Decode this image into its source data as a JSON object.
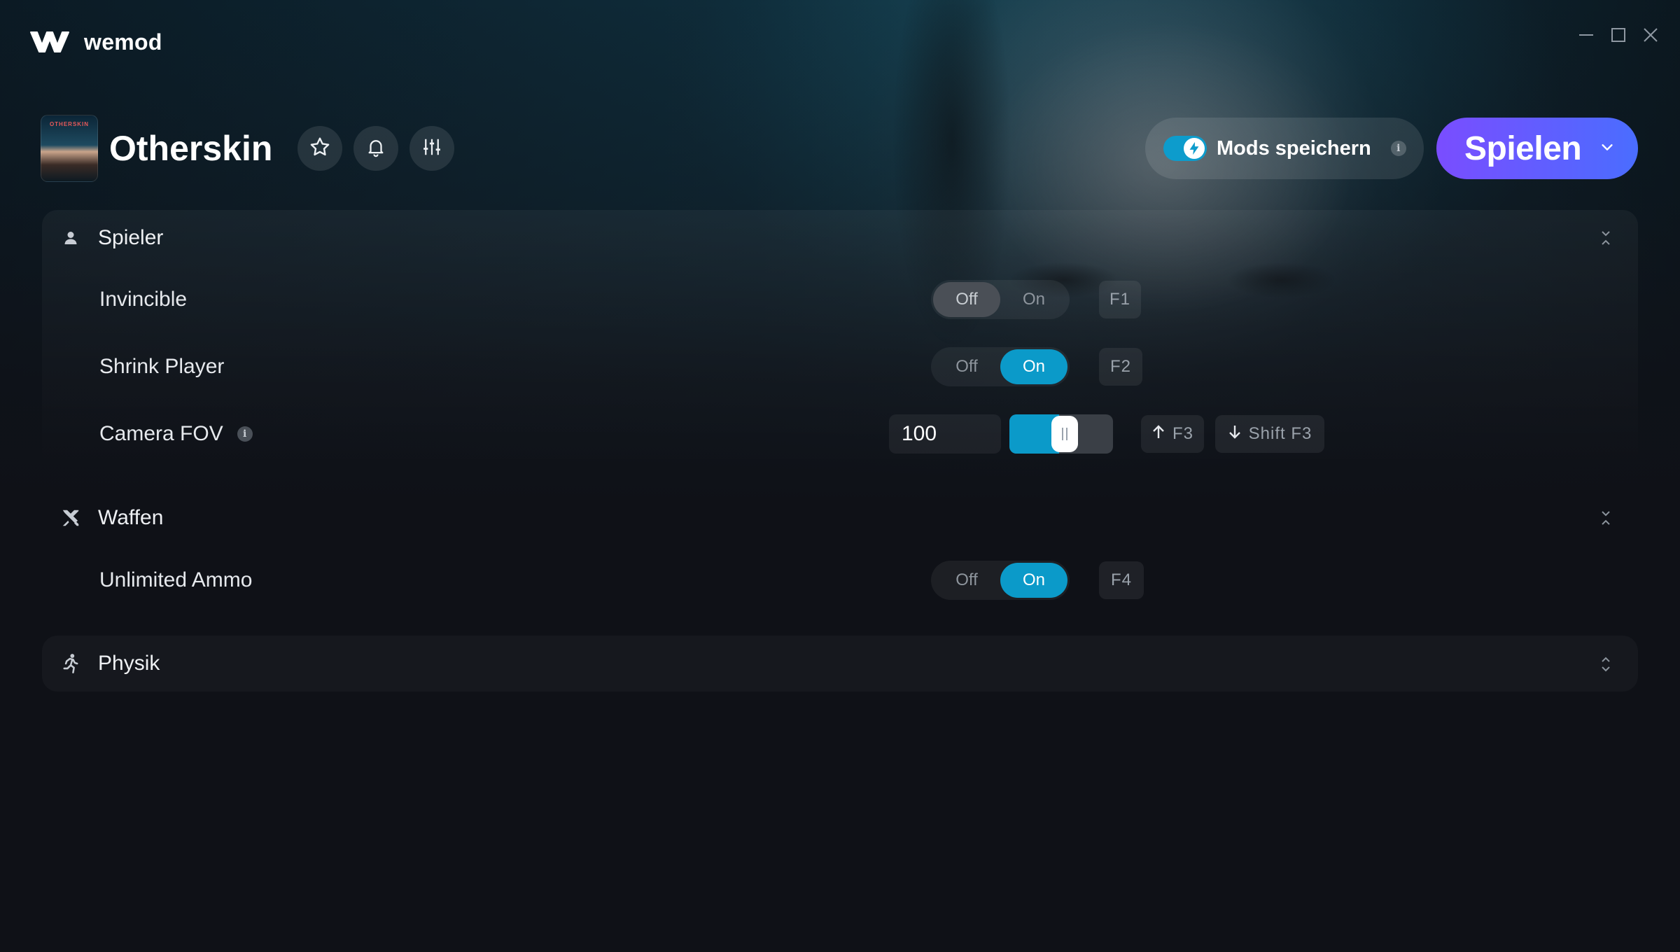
{
  "app": {
    "name": "wemod"
  },
  "game": {
    "title": "Otherskin",
    "cover_text": "OTHERSKIN"
  },
  "header_actions": {
    "favorite_icon": "star-icon",
    "notify_icon": "bell-icon",
    "settings_icon": "sliders-icon"
  },
  "save_mods": {
    "label": "Mods speichern",
    "info": "i",
    "enabled": true
  },
  "play": {
    "label": "Spielen"
  },
  "sections": [
    {
      "title": "Spieler",
      "icon": "person-icon",
      "expanded": true,
      "mods": [
        {
          "label": "Invincible",
          "type": "toggle",
          "off_label": "Off",
          "on_label": "On",
          "state": "off",
          "hotkey": "F1"
        },
        {
          "label": "Shrink Player",
          "type": "toggle",
          "off_label": "Off",
          "on_label": "On",
          "state": "on",
          "hotkey": "F2"
        },
        {
          "label": "Camera FOV",
          "type": "slider",
          "info": "i",
          "value": "100",
          "fill_fraction": 0.48,
          "hotkey_up": "F3",
          "hotkey_down": "Shift F3"
        }
      ]
    },
    {
      "title": "Waffen",
      "icon": "crossed-swords-icon",
      "expanded": true,
      "mods": [
        {
          "label": "Unlimited Ammo",
          "type": "toggle",
          "off_label": "Off",
          "on_label": "On",
          "state": "on",
          "hotkey": "F4"
        }
      ]
    },
    {
      "title": "Physik",
      "icon": "running-person-icon",
      "expanded": false
    }
  ],
  "colors": {
    "accent": "#0b9ac9",
    "play_gradient_start": "#7a4dff",
    "play_gradient_end": "#4a6dff",
    "background": "#0f1117"
  }
}
